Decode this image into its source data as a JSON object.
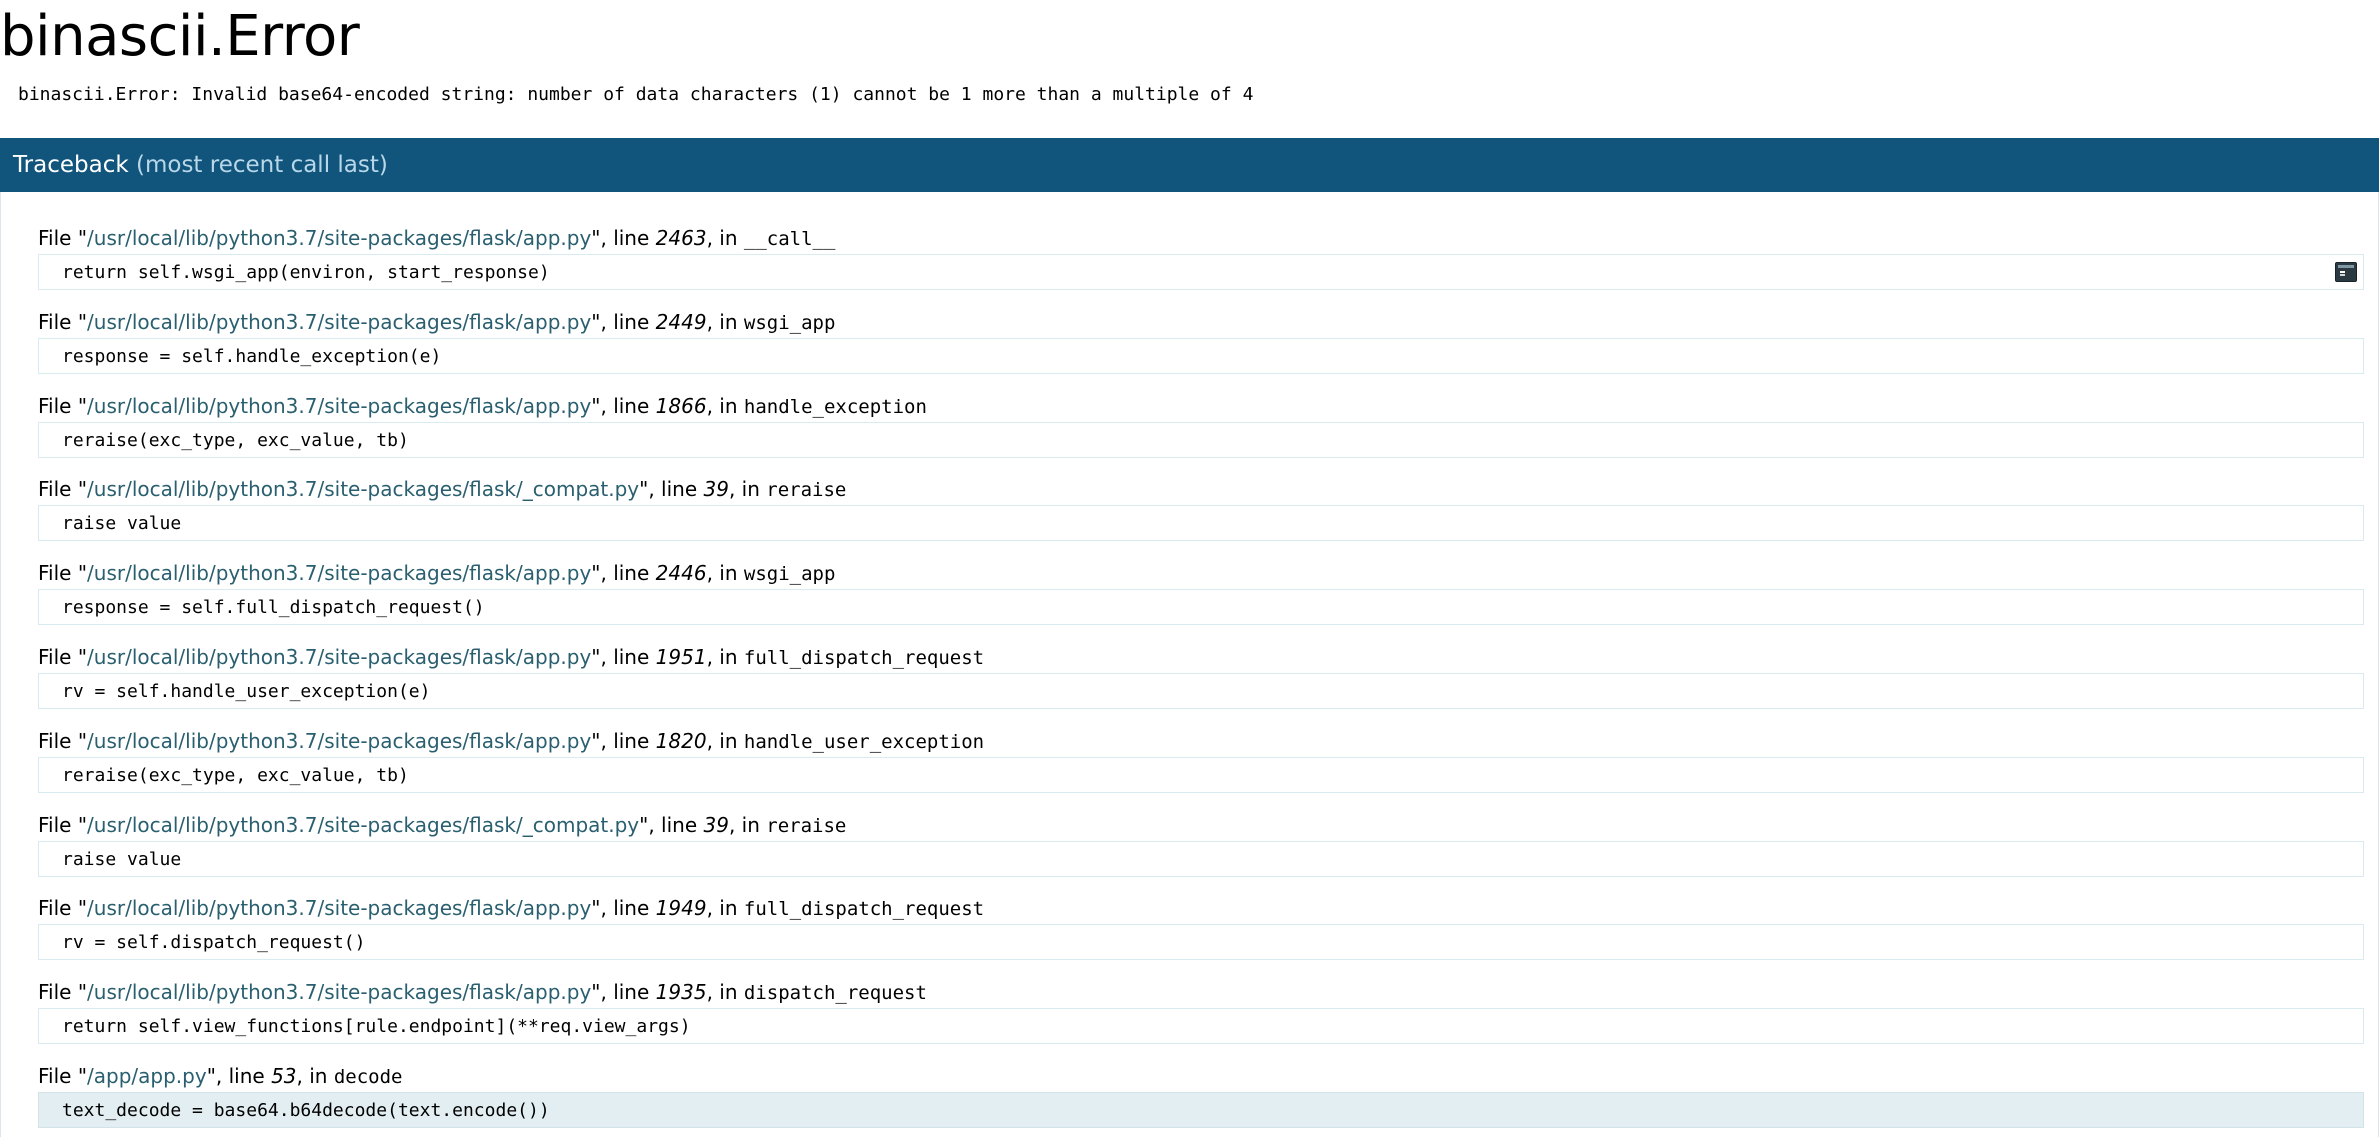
{
  "error": {
    "title": "binascii.Error",
    "message": "binascii.Error: Invalid base64-encoded string: number of data characters (1) cannot be 1 more than a multiple of 4"
  },
  "traceback": {
    "title": "Traceback",
    "subtitle": "(most recent call last)",
    "labels": {
      "file": "File \"",
      "line": "\", line ",
      "in": ", in "
    },
    "frames": [
      {
        "file": "/usr/local/lib/python3.7/site-packages/flask/app.py",
        "line": "2463",
        "func": "__call__",
        "code": "return self.wsgi_app(environ, start_response)"
      },
      {
        "file": "/usr/local/lib/python3.7/site-packages/flask/app.py",
        "line": "2449",
        "func": "wsgi_app",
        "code": "response = self.handle_exception(e)"
      },
      {
        "file": "/usr/local/lib/python3.7/site-packages/flask/app.py",
        "line": "1866",
        "func": "handle_exception",
        "code": "reraise(exc_type, exc_value, tb)"
      },
      {
        "file": "/usr/local/lib/python3.7/site-packages/flask/_compat.py",
        "line": "39",
        "func": "reraise",
        "code": "raise value"
      },
      {
        "file": "/usr/local/lib/python3.7/site-packages/flask/app.py",
        "line": "2446",
        "func": "wsgi_app",
        "code": "response = self.full_dispatch_request()"
      },
      {
        "file": "/usr/local/lib/python3.7/site-packages/flask/app.py",
        "line": "1951",
        "func": "full_dispatch_request",
        "code": "rv = self.handle_user_exception(e)"
      },
      {
        "file": "/usr/local/lib/python3.7/site-packages/flask/app.py",
        "line": "1820",
        "func": "handle_user_exception",
        "code": "reraise(exc_type, exc_value, tb)"
      },
      {
        "file": "/usr/local/lib/python3.7/site-packages/flask/_compat.py",
        "line": "39",
        "func": "reraise",
        "code": "raise value"
      },
      {
        "file": "/usr/local/lib/python3.7/site-packages/flask/app.py",
        "line": "1949",
        "func": "full_dispatch_request",
        "code": "rv = self.dispatch_request()"
      },
      {
        "file": "/usr/local/lib/python3.7/site-packages/flask/app.py",
        "line": "1935",
        "func": "dispatch_request",
        "code": "return self.view_functions[rule.endpoint](**req.view_args)"
      },
      {
        "file": "/app/app.py",
        "line": "53",
        "func": "decode",
        "code": "text_decode = base64.b64decode(text.encode())"
      }
    ]
  },
  "icons": {
    "console": "console-icon"
  },
  "colors": {
    "header_bg": "#11557c",
    "header_sub": "#b8d8ea",
    "filename": "#2a5f6f",
    "code_border": "#d9ebf0",
    "current_line_bg": "#e2eef2"
  }
}
